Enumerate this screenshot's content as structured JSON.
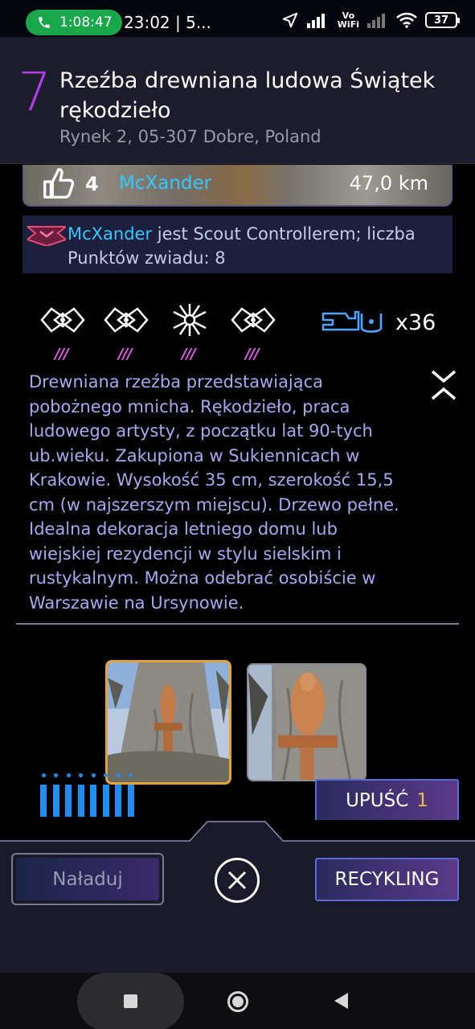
{
  "status_bar": {
    "call_timer": "1:08:47",
    "time": "23:02 | 5...",
    "network_label_top": "Vo",
    "network_label_bottom": "WiFi",
    "battery": "37"
  },
  "portal": {
    "level": "7",
    "title": "Rzeźba drewniana ludowa Świątek rękodzieło",
    "address": "Rynek 2, 05-307 Dobre, Poland",
    "likes": "4",
    "owner": "McXander",
    "distance": "47,0 km"
  },
  "scout": {
    "name": "McXander",
    "text": " jest Scout Controllerem; liczba Punktów zwiadu: 8"
  },
  "mods": [
    {
      "icon": "shield-mod-icon",
      "rarity_marks": "///"
    },
    {
      "icon": "shield-mod-icon",
      "rarity_marks": "///"
    },
    {
      "icon": "multi-hack-mod-icon",
      "rarity_marks": "///"
    },
    {
      "icon": "shield-mod-icon",
      "rarity_marks": "///"
    }
  ],
  "keys": {
    "icon": "portal-key-icon",
    "count": "x36"
  },
  "description": "Drewniana rzeźba przedstawiająca pobożnego mnicha. Rękodzieło, praca ludowego artysty, z początku lat 90-tych ub.wieku. Zakupiona w Sukiennicach w Krakowie. Wysokość 35 cm, szerokość 15,5 cm (w najszerszym miejscu). Drzewo pełne. Idealna dekoracja letniego domu lub wiejskiej rezydencji w stylu sielskim i rustykalnym. Można odebrać osobiście w Warszawie na Ursynowie.",
  "energy_level": 8,
  "actions": {
    "drop_label": "UPUŚĆ",
    "drop_count": "1",
    "recharge_label": "Naładuj",
    "recycle_label": "RECYKLING"
  },
  "colors": {
    "level": "#b23ce6",
    "owner": "#33c8ff",
    "description": "#a8a8f0",
    "selected_border": "#e8a23a",
    "energy": "#1e8ff0"
  }
}
